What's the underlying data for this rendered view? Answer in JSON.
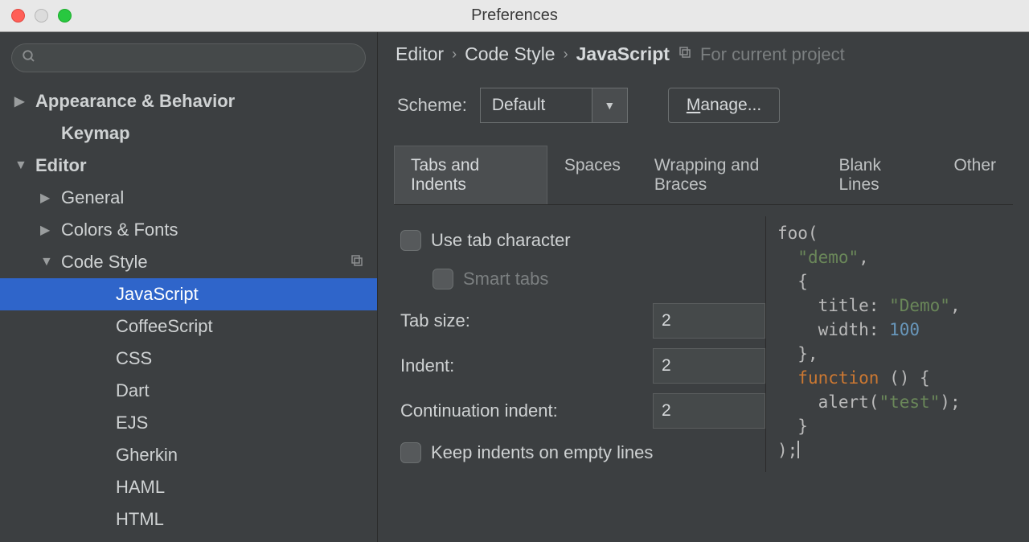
{
  "window": {
    "title": "Preferences"
  },
  "sidebar": {
    "items": [
      {
        "label": "Appearance & Behavior",
        "arrow": "right",
        "bold": true,
        "indent": 0
      },
      {
        "label": "Keymap",
        "arrow": "",
        "bold": true,
        "indent": 1
      },
      {
        "label": "Editor",
        "arrow": "down",
        "bold": true,
        "indent": 0
      },
      {
        "label": "General",
        "arrow": "right",
        "bold": false,
        "indent": 1
      },
      {
        "label": "Colors & Fonts",
        "arrow": "right",
        "bold": false,
        "indent": 1
      },
      {
        "label": "Code Style",
        "arrow": "down",
        "bold": false,
        "indent": 1,
        "copyIcon": true
      },
      {
        "label": "JavaScript",
        "arrow": "",
        "bold": false,
        "indent": 3,
        "selected": true
      },
      {
        "label": "CoffeeScript",
        "arrow": "",
        "bold": false,
        "indent": 3
      },
      {
        "label": "CSS",
        "arrow": "",
        "bold": false,
        "indent": 3
      },
      {
        "label": "Dart",
        "arrow": "",
        "bold": false,
        "indent": 3
      },
      {
        "label": "EJS",
        "arrow": "",
        "bold": false,
        "indent": 3
      },
      {
        "label": "Gherkin",
        "arrow": "",
        "bold": false,
        "indent": 3
      },
      {
        "label": "HAML",
        "arrow": "",
        "bold": false,
        "indent": 3
      },
      {
        "label": "HTML",
        "arrow": "",
        "bold": false,
        "indent": 3
      }
    ]
  },
  "breadcrumb": {
    "p0": "Editor",
    "p1": "Code Style",
    "p2": "JavaScript",
    "scope": "For current project"
  },
  "scheme": {
    "label": "Scheme:",
    "value": "Default",
    "manage": "anage..."
  },
  "tabs": [
    {
      "label": "Tabs and Indents",
      "active": true
    },
    {
      "label": "Spaces"
    },
    {
      "label": "Wrapping and Braces"
    },
    {
      "label": "Blank Lines"
    },
    {
      "label": "Other"
    }
  ],
  "settings": {
    "useTab": "Use tab character",
    "smartTabs": "Smart tabs",
    "tabSizeLabel": "Tab size:",
    "tabSize": "2",
    "indentLabel": "Indent:",
    "indent": "2",
    "contLabel": "Continuation indent:",
    "cont": "2",
    "keepEmpty": "Keep indents on empty lines"
  },
  "preview": {
    "l1a": "foo(",
    "l2_str": "\"demo\"",
    "l3": "  {",
    "l4_prop": "title",
    "l4_str": "\"Demo\"",
    "l5_prop": "width",
    "l5_num": "100",
    "l6": "  },",
    "l7_kw": "function",
    "l7_rest": " () {",
    "l8a": "    alert(",
    "l8_str": "\"test\"",
    "l8b": ");",
    "l9": "  }",
    "l10": ");"
  }
}
